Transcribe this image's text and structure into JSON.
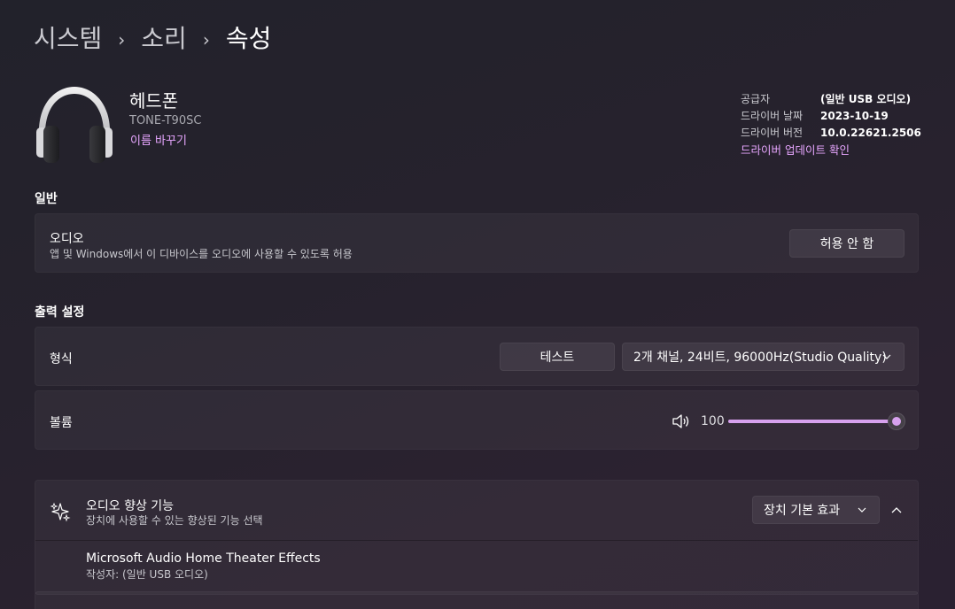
{
  "breadcrumb": {
    "item1": "시스템",
    "item2": "소리",
    "item3": "속성",
    "separator": "›"
  },
  "device": {
    "name": "헤드폰",
    "model": "TONE-T90SC",
    "rename_link": "이름 바꾸기",
    "icon": "headphone-icon"
  },
  "driver_info": {
    "vendor_label": "공급자",
    "vendor_value": "(일반 USB 오디오)",
    "date_label": "드라이버 날짜",
    "date_value": "2023-10-19",
    "version_label": "드라이버 버전",
    "version_value": "10.0.22621.2506",
    "update_link": "드라이버 업데이트 확인"
  },
  "general": {
    "title": "일반",
    "audio_title": "오디오",
    "audio_sub": "앱 및 Windows에서 이 디바이스를 오디오에 사용할 수 있도록 허용",
    "audio_button": "허용 안 함"
  },
  "output": {
    "title": "출력 설정",
    "format_label": "형식",
    "test_button": "테스트",
    "format_value": "2개 채널, 24비트, 96000Hz(Studio Quality)",
    "volume_label": "볼륨",
    "volume_value": "100",
    "volume_level_percent": 100
  },
  "enhance": {
    "title": "오디오 향상 기능",
    "sub": "장치에 사용할 수 있는 향상된 기능 선택",
    "dropdown_value": "장치 기본 효과",
    "effect_name": "Microsoft Audio Home Theater Effects",
    "effect_author": "작성자: (일반 USB 오디오)"
  },
  "colors": {
    "accent": "#d7a1ee",
    "link": "#e7a6ff",
    "background": "#24212b"
  }
}
